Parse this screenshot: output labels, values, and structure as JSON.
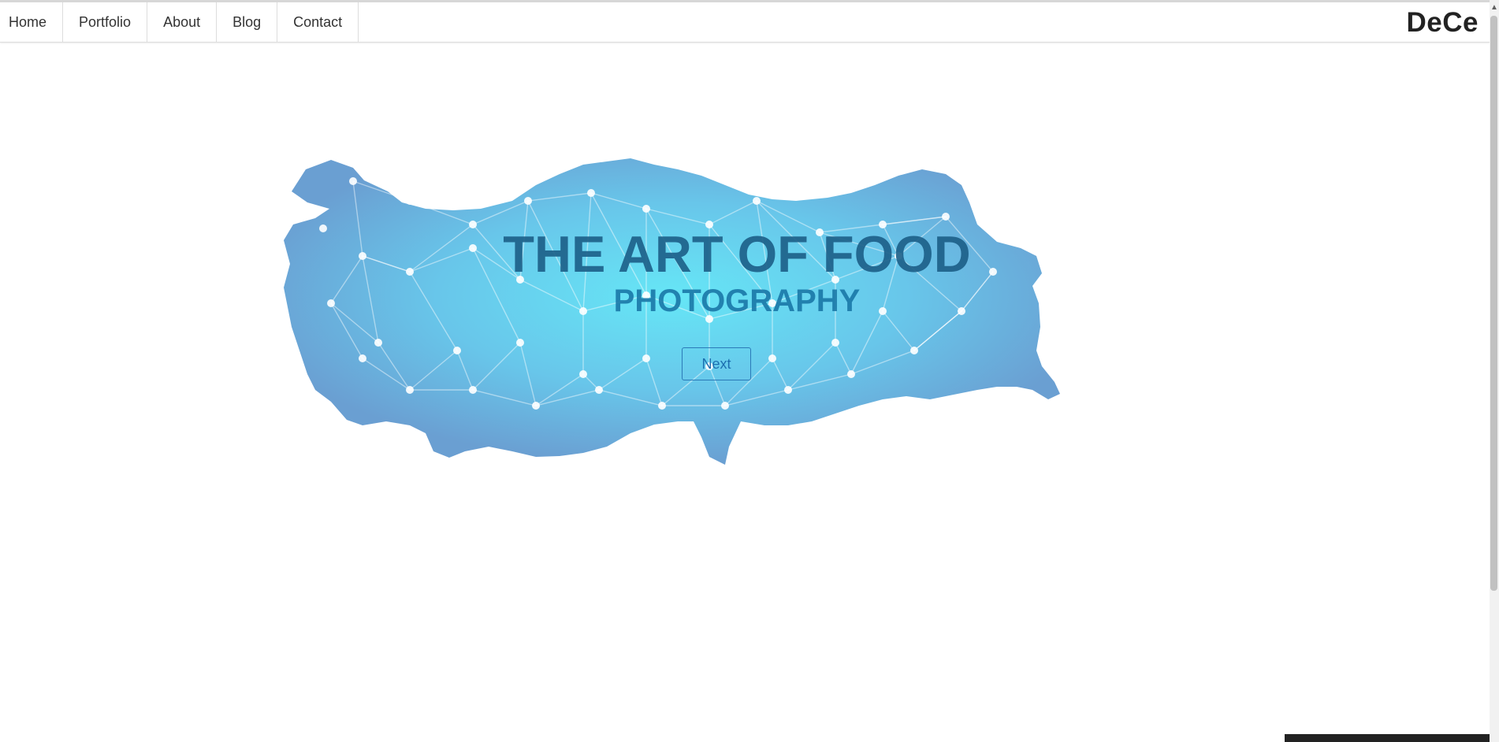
{
  "nav": {
    "items": [
      "Home",
      "Portfolio",
      "About",
      "Blog",
      "Contact"
    ],
    "brand": "DeCe"
  },
  "hero": {
    "title": "THE ART OF FOOD",
    "subtitle": "PHOTOGRAPHY",
    "button_label": "Next",
    "map_icon": "turkey-map-network-icon"
  },
  "colors": {
    "map_outer": "#6aa9d6",
    "map_center": "#66e4f5",
    "title": "#1c5f88",
    "button": "#2b7ab8"
  }
}
